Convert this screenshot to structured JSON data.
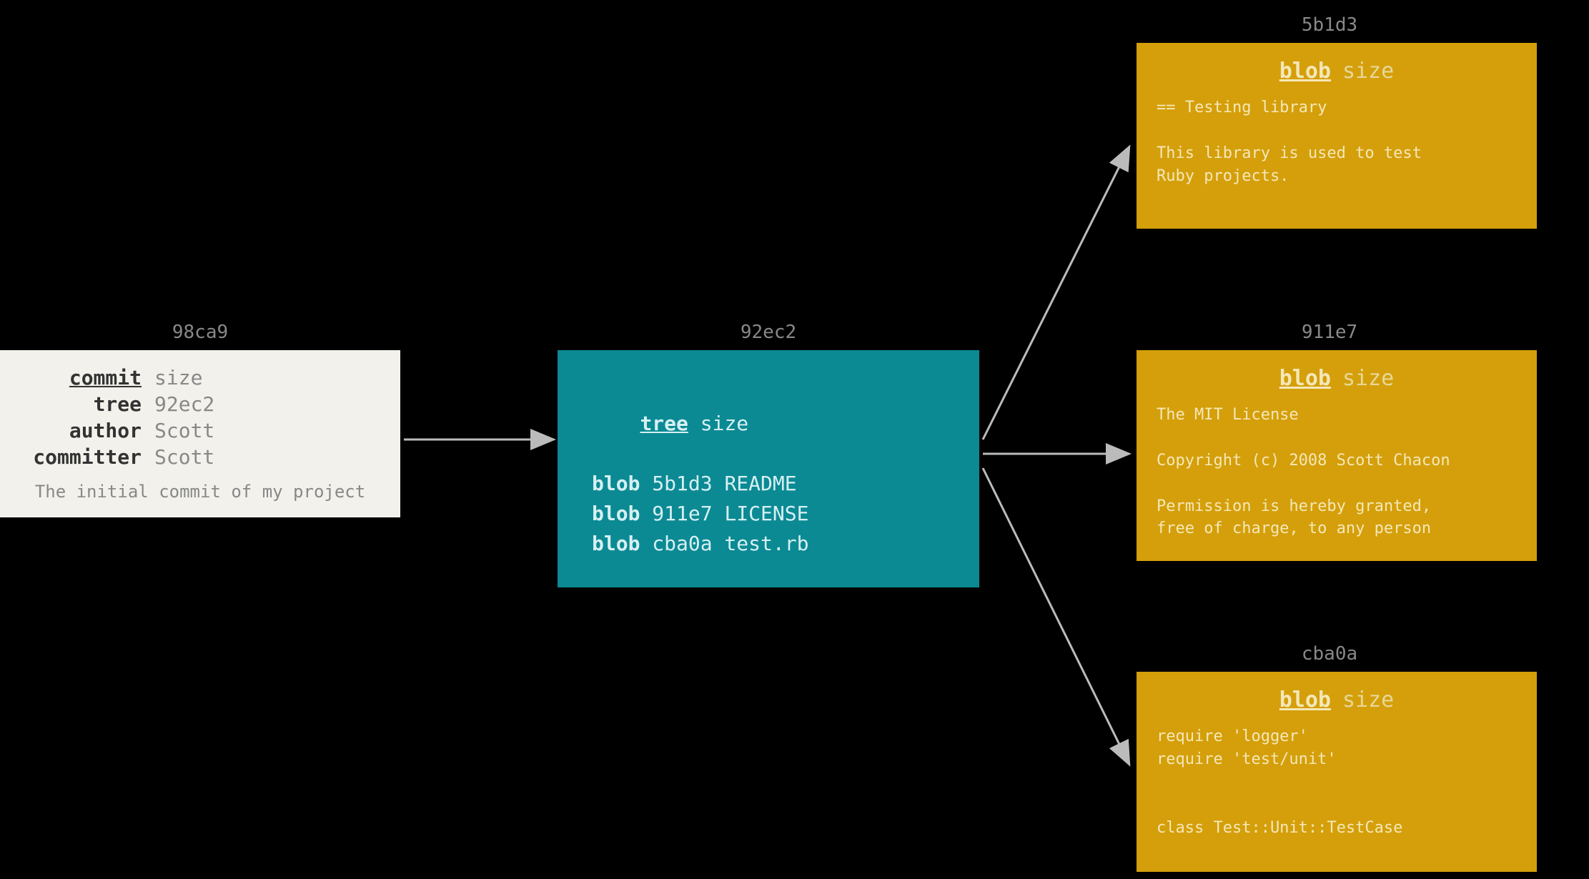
{
  "commit": {
    "hash": "98ca9",
    "type_label": "commit",
    "size_label": "size",
    "rows": [
      {
        "key": "tree",
        "val": "92ec2"
      },
      {
        "key": "author",
        "val": "Scott"
      },
      {
        "key": "committer",
        "val": "Scott"
      }
    ],
    "message": "The initial commit of my project"
  },
  "tree": {
    "hash": "92ec2",
    "type_label": "tree",
    "size_label": "size",
    "entries": [
      {
        "type": "blob",
        "hash": "5b1d3",
        "name": "README"
      },
      {
        "type": "blob",
        "hash": "911e7",
        "name": "LICENSE"
      },
      {
        "type": "blob",
        "hash": "cba0a",
        "name": "test.rb"
      }
    ]
  },
  "blobs": [
    {
      "hash": "5b1d3",
      "type_label": "blob",
      "size_label": "size",
      "content": "== Testing library\n\nThis library is used to test\nRuby projects."
    },
    {
      "hash": "911e7",
      "type_label": "blob",
      "size_label": "size",
      "content": "The MIT License\n\nCopyright (c) 2008 Scott Chacon\n\nPermission is hereby granted,\nfree of charge, to any person"
    },
    {
      "hash": "cba0a",
      "type_label": "blob",
      "size_label": "size",
      "content": "require 'logger'\nrequire 'test/unit'\n\n\nclass Test::Unit::TestCase"
    }
  ]
}
